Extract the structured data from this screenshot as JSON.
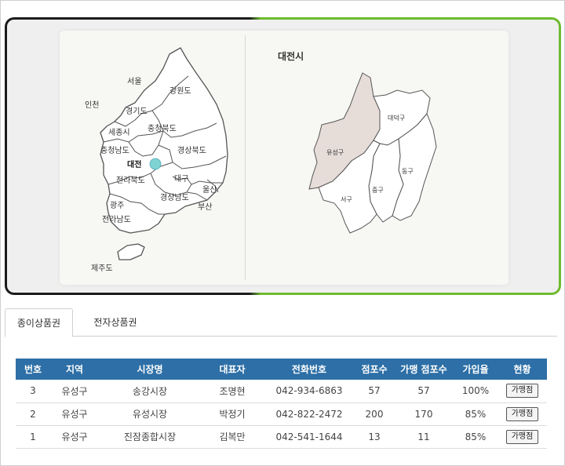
{
  "map": {
    "city_title": "대전시",
    "provinces": {
      "seoul": "서울",
      "incheon": "인천",
      "gangwon": "강원도",
      "gyeonggi": "경기도",
      "sejong": "세종시",
      "chungbuk": "충청북도",
      "chungnam": "충청남도",
      "daejeon": "대전",
      "gyeongbuk": "경상북도",
      "jeonbuk": "전라북도",
      "daegu": "대구",
      "ulsan": "울산",
      "gyeongnam": "경상남도",
      "gwangju": "광주",
      "busan": "부산",
      "jeonnam": "전라남도",
      "jeju": "제주도"
    },
    "districts": {
      "yuseong": "유성구",
      "daedeok": "대덕구",
      "dong": "동구",
      "jung": "중구",
      "seo": "서구"
    },
    "colors": {
      "highlight_district": "#e6dcd8",
      "daejeon_marker": "#7fd3d3",
      "map_fill": "#ffffff",
      "map_stroke": "#555555"
    }
  },
  "tabs": {
    "paper": "종이상품권",
    "electronic": "전자상품권"
  },
  "table": {
    "headers": [
      "번호",
      "지역",
      "시장명",
      "대표자",
      "전화번호",
      "점포수",
      "가맹 점포수",
      "가입율",
      "현황"
    ],
    "rows": [
      {
        "no": "3",
        "region": "유성구",
        "market": "송강시장",
        "rep": "조명현",
        "phone": "042-934-6863",
        "stores": "57",
        "member_stores": "57",
        "rate": "100%",
        "status": "가맹점"
      },
      {
        "no": "2",
        "region": "유성구",
        "market": "유성시장",
        "rep": "박정기",
        "phone": "042-822-2472",
        "stores": "200",
        "member_stores": "170",
        "rate": "85%",
        "status": "가맹점"
      },
      {
        "no": "1",
        "region": "유성구",
        "market": "진잠종합시장",
        "rep": "김복만",
        "phone": "042-541-1644",
        "stores": "13",
        "member_stores": "11",
        "rate": "85%",
        "status": "가맹점"
      }
    ]
  }
}
